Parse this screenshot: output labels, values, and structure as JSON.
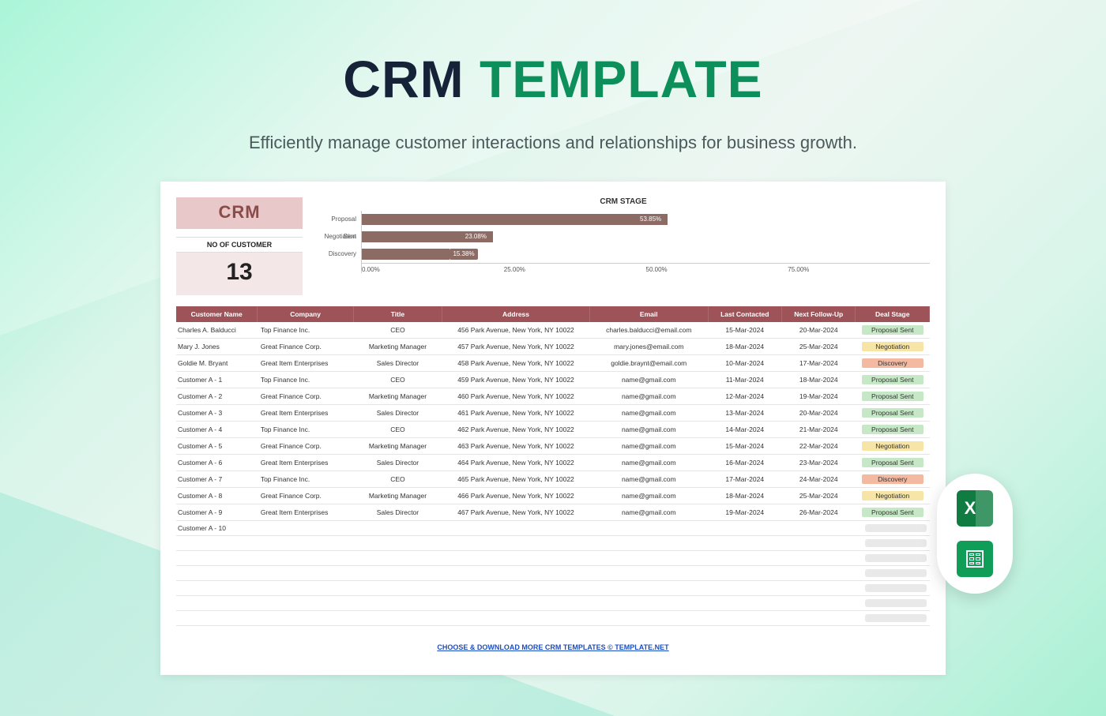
{
  "hero": {
    "title_word1": "CRM",
    "title_word2": "TEMPLATE",
    "subtitle": "Efficiently manage customer interactions and relationships for business growth."
  },
  "crm_box": {
    "title": "CRM",
    "subtitle": "NO OF CUSTOMER",
    "count": "13"
  },
  "chart_data": {
    "type": "bar",
    "orientation": "horizontal",
    "title": "CRM STAGE",
    "xlabel": "",
    "ylabel": "",
    "xlim": [
      0,
      100
    ],
    "x_ticks": [
      "0.00%",
      "25.00%",
      "50.00%",
      "75.00%"
    ],
    "categories": [
      "Proposal Sent",
      "Negotiation",
      "Discovery"
    ],
    "values": [
      53.85,
      23.08,
      15.38
    ],
    "value_labels": [
      "53.85%",
      "23.08%",
      "15.38%"
    ]
  },
  "table": {
    "headers": [
      "Customer Name",
      "Company",
      "Title",
      "Address",
      "Email",
      "Last Contacted",
      "Next Follow-Up",
      "Deal Stage"
    ],
    "rows": [
      {
        "name": "Charles A. Balducci",
        "company": "Top Finance Inc.",
        "title": "CEO",
        "address": "456 Park Avenue, New York, NY 10022",
        "email": "charles.balducci@email.com",
        "last": "15-Mar-2024",
        "next": "20-Mar-2024",
        "stage": "Proposal Sent",
        "stage_class": "stage-proposal"
      },
      {
        "name": "Mary J. Jones",
        "company": "Great Finance Corp.",
        "title": "Marketing Manager",
        "address": "457 Park Avenue, New York, NY 10022",
        "email": "mary.jones@email.com",
        "last": "18-Mar-2024",
        "next": "25-Mar-2024",
        "stage": "Negotiation",
        "stage_class": "stage-negotiation"
      },
      {
        "name": "Goldie M. Bryant",
        "company": "Great Item Enterprises",
        "title": "Sales Director",
        "address": "458 Park Avenue, New York, NY 10022",
        "email": "goldie.braynt@email.com",
        "last": "10-Mar-2024",
        "next": "17-Mar-2024",
        "stage": "Discovery",
        "stage_class": "stage-discovery"
      },
      {
        "name": "Customer A - 1",
        "company": "Top Finance Inc.",
        "title": "CEO",
        "address": "459 Park Avenue, New York, NY 10022",
        "email": "name@gmail.com",
        "last": "11-Mar-2024",
        "next": "18-Mar-2024",
        "stage": "Proposal Sent",
        "stage_class": "stage-proposal"
      },
      {
        "name": "Customer A - 2",
        "company": "Great Finance Corp.",
        "title": "Marketing Manager",
        "address": "460 Park Avenue, New York, NY 10022",
        "email": "name@gmail.com",
        "last": "12-Mar-2024",
        "next": "19-Mar-2024",
        "stage": "Proposal Sent",
        "stage_class": "stage-proposal"
      },
      {
        "name": "Customer A - 3",
        "company": "Great Item Enterprises",
        "title": "Sales Director",
        "address": "461 Park Avenue, New York, NY 10022",
        "email": "name@gmail.com",
        "last": "13-Mar-2024",
        "next": "20-Mar-2024",
        "stage": "Proposal Sent",
        "stage_class": "stage-proposal"
      },
      {
        "name": "Customer A - 4",
        "company": "Top Finance Inc.",
        "title": "CEO",
        "address": "462 Park Avenue, New York, NY 10022",
        "email": "name@gmail.com",
        "last": "14-Mar-2024",
        "next": "21-Mar-2024",
        "stage": "Proposal Sent",
        "stage_class": "stage-proposal"
      },
      {
        "name": "Customer A - 5",
        "company": "Great Finance Corp.",
        "title": "Marketing Manager",
        "address": "463 Park Avenue, New York, NY 10022",
        "email": "name@gmail.com",
        "last": "15-Mar-2024",
        "next": "22-Mar-2024",
        "stage": "Negotiation",
        "stage_class": "stage-negotiation"
      },
      {
        "name": "Customer A - 6",
        "company": "Great Item Enterprises",
        "title": "Sales Director",
        "address": "464 Park Avenue, New York, NY 10022",
        "email": "name@gmail.com",
        "last": "16-Mar-2024",
        "next": "23-Mar-2024",
        "stage": "Proposal Sent",
        "stage_class": "stage-proposal"
      },
      {
        "name": "Customer A - 7",
        "company": "Top Finance Inc.",
        "title": "CEO",
        "address": "465 Park Avenue, New York, NY 10022",
        "email": "name@gmail.com",
        "last": "17-Mar-2024",
        "next": "24-Mar-2024",
        "stage": "Discovery",
        "stage_class": "stage-discovery"
      },
      {
        "name": "Customer A - 8",
        "company": "Great Finance Corp.",
        "title": "Marketing Manager",
        "address": "466 Park Avenue, New York, NY 10022",
        "email": "name@gmail.com",
        "last": "18-Mar-2024",
        "next": "25-Mar-2024",
        "stage": "Negotiation",
        "stage_class": "stage-negotiation"
      },
      {
        "name": "Customer A - 9",
        "company": "Great Item Enterprises",
        "title": "Sales Director",
        "address": "467 Park Avenue, New York, NY 10022",
        "email": "name@gmail.com",
        "last": "19-Mar-2024",
        "next": "26-Mar-2024",
        "stage": "Proposal Sent",
        "stage_class": "stage-proposal"
      },
      {
        "name": "Customer A - 10",
        "company": "",
        "title": "",
        "address": "",
        "email": "",
        "last": "",
        "next": "",
        "stage": "",
        "stage_class": ""
      }
    ],
    "empty_rows": 6
  },
  "footer_link": "CHOOSE & DOWNLOAD MORE CRM TEMPLATES  ©  TEMPLATE.NET"
}
